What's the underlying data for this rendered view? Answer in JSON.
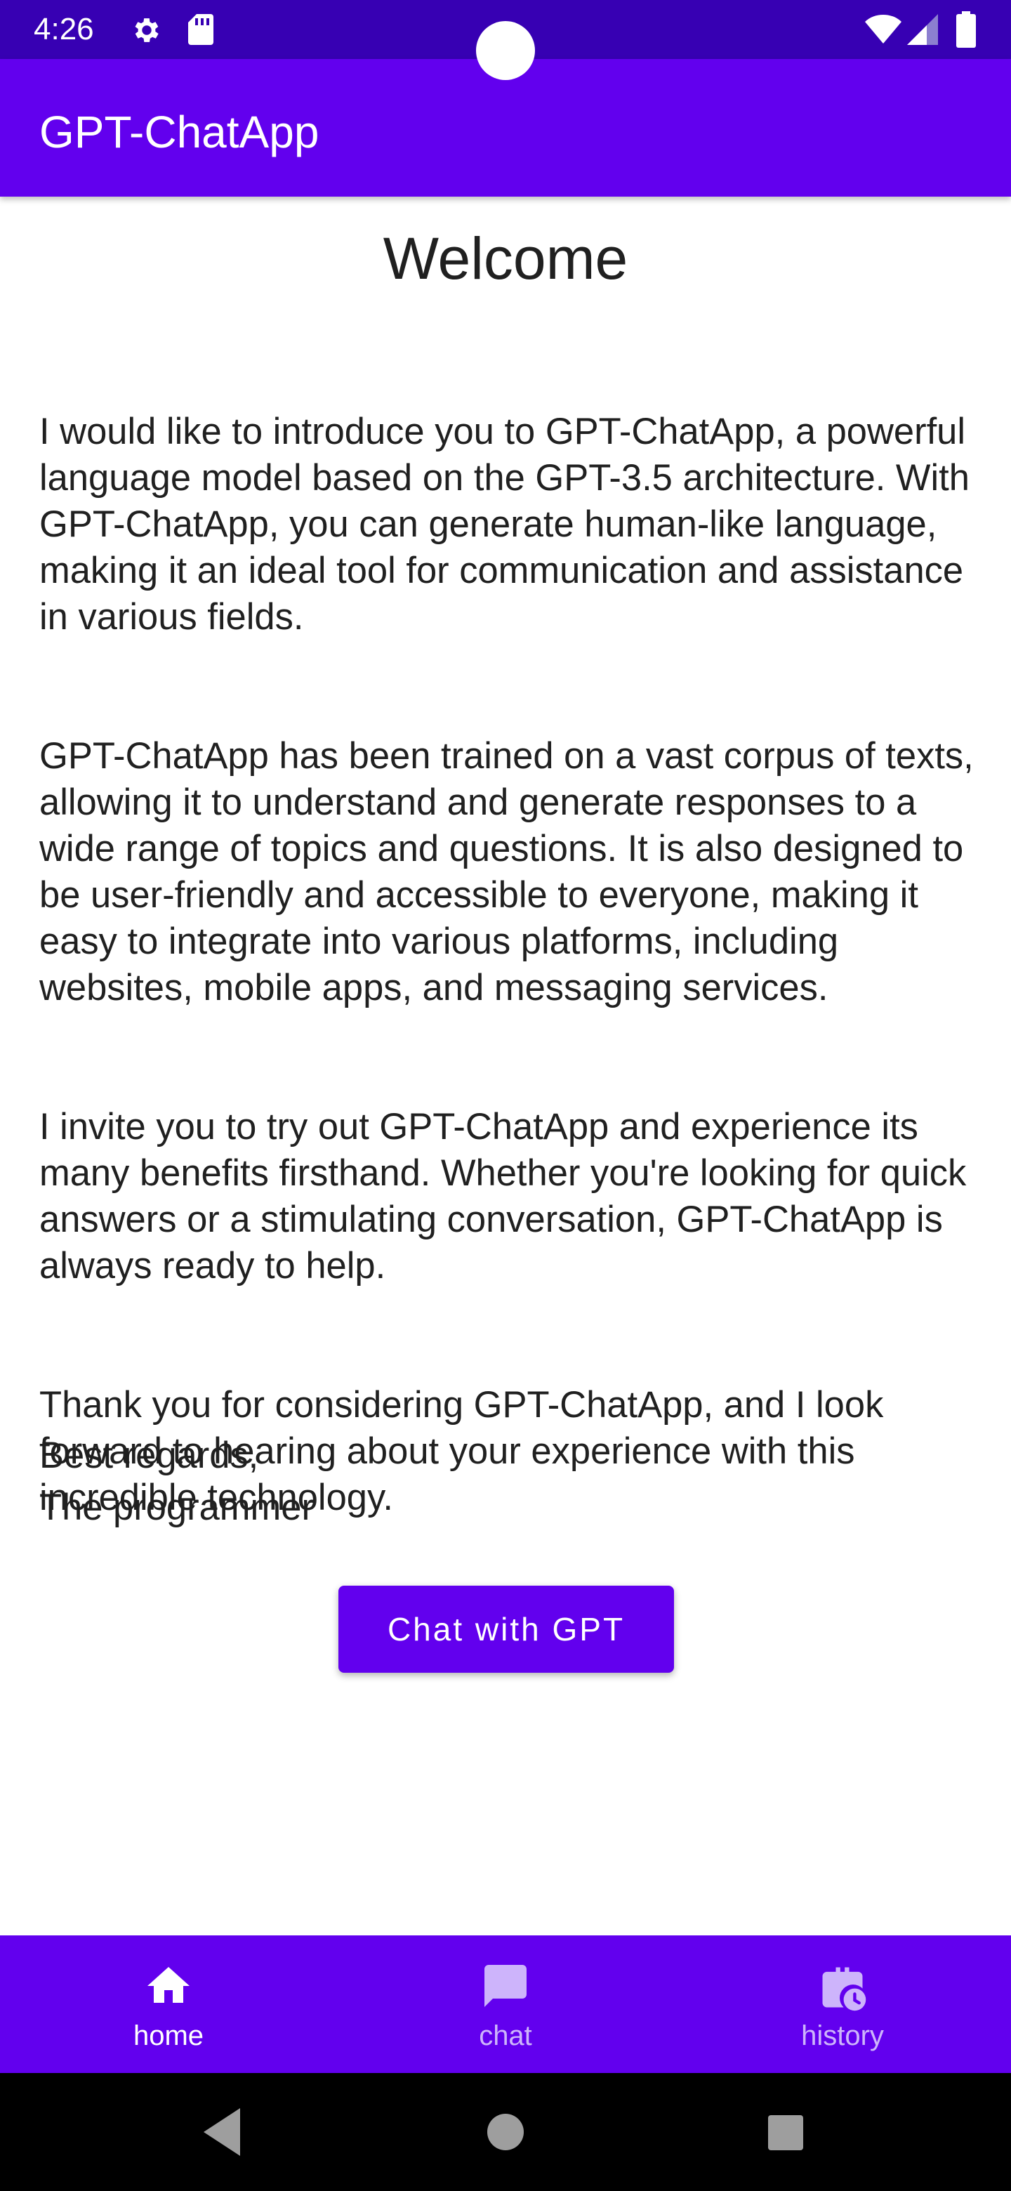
{
  "status_bar": {
    "time": "4:26",
    "icons": [
      "gear-icon",
      "sd-card-icon",
      "wifi-icon",
      "signal-icon",
      "battery-icon"
    ]
  },
  "app_bar": {
    "title": "GPT-ChatApp"
  },
  "content": {
    "title": "Welcome",
    "paragraphs": [
      "I would like to introduce you to GPT-ChatApp, a powerful language model based on the GPT-3.5 architecture. With GPT-ChatApp, you can generate human-like language, making it an ideal tool for communication and assistance in various fields.",
      "GPT-ChatApp has been trained on a vast corpus of texts, allowing it to understand and generate responses to a wide range of topics and questions. It is also designed to be user-friendly and accessible to everyone, making it easy to integrate into various platforms, including websites, mobile apps, and messaging services.",
      "I invite you to try out GPT-ChatApp and experience its many benefits firsthand. Whether you're looking for quick answers or a stimulating conversation, GPT-ChatApp is always ready to help.",
      "Thank you for considering GPT-ChatApp, and I look forward to hearing about your experience with this incredible technology."
    ],
    "closing": "Best regards,",
    "signature": "The programmer",
    "button_label": "Chat with GPT"
  },
  "bottom_nav": {
    "items": [
      {
        "label": "home",
        "icon": "home-icon",
        "active": true
      },
      {
        "label": "chat",
        "icon": "chat-icon",
        "active": false
      },
      {
        "label": "history",
        "icon": "history-icon",
        "active": false
      }
    ]
  },
  "system_nav": {
    "icons": [
      "back-icon",
      "home-circle-icon",
      "recents-icon"
    ]
  },
  "colors": {
    "status_bar": "#3700b3",
    "primary": "#6200ee",
    "text": "#202020",
    "nav_inactive": "#cdb4fb"
  }
}
